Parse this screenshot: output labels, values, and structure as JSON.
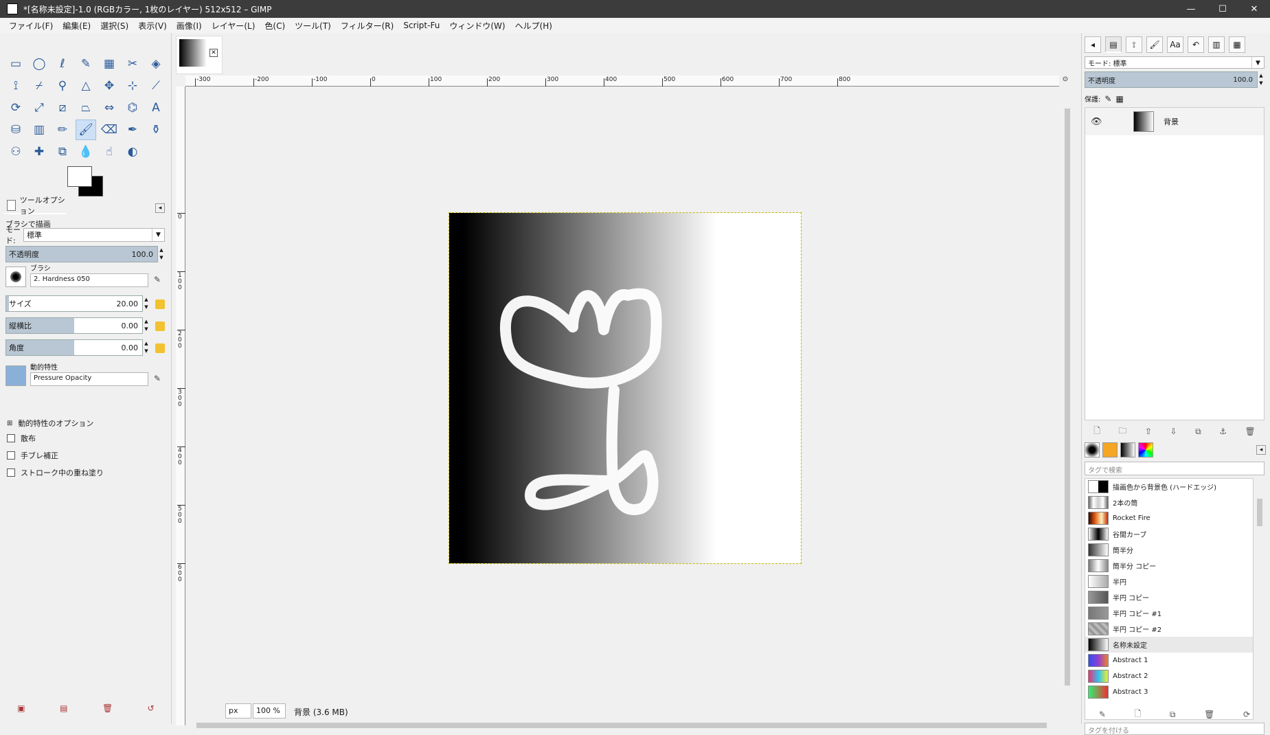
{
  "titlebar": {
    "title": "*[名称未設定]-1.0 (RGBカラー, 1枚のレイヤー) 512x512 – GIMP",
    "minimize": "—",
    "maximize": "☐",
    "close": "✕"
  },
  "menu": [
    "ファイル(F)",
    "編集(E)",
    "選択(S)",
    "表示(V)",
    "画像(I)",
    "レイヤー(L)",
    "色(C)",
    "ツール(T)",
    "フィルター(R)",
    "Script-Fu",
    "ウィンドウ(W)",
    "ヘルプ(H)"
  ],
  "tools": [
    {
      "name": "rect-select-tool",
      "glyph": "▭"
    },
    {
      "name": "ellipse-select-tool",
      "glyph": "◯"
    },
    {
      "name": "free-select-tool",
      "glyph": "ℓ"
    },
    {
      "name": "fuzzy-select-tool",
      "glyph": "✎"
    },
    {
      "name": "select-by-color-tool",
      "glyph": "▦"
    },
    {
      "name": "scissors-select-tool",
      "glyph": "✂"
    },
    {
      "name": "foreground-select-tool",
      "glyph": "◈"
    },
    {
      "name": "paths-tool",
      "glyph": "⟟"
    },
    {
      "name": "color-picker-tool",
      "glyph": "⌿"
    },
    {
      "name": "zoom-tool",
      "glyph": "⚲"
    },
    {
      "name": "measure-tool",
      "glyph": "△"
    },
    {
      "name": "move-tool",
      "glyph": "✥"
    },
    {
      "name": "align-tool",
      "glyph": "⊹"
    },
    {
      "name": "crop-tool",
      "glyph": "⟋"
    },
    {
      "name": "unified-transform-tool",
      "glyph": "⟳"
    },
    {
      "name": "scale-tool",
      "glyph": "⤢"
    },
    {
      "name": "shear-tool",
      "glyph": "⧄"
    },
    {
      "name": "perspective-tool",
      "glyph": "⏢"
    },
    {
      "name": "flip-tool",
      "glyph": "⇔"
    },
    {
      "name": "cage-tool",
      "glyph": "⌬"
    },
    {
      "name": "text-tool",
      "glyph": "A"
    },
    {
      "name": "bucket-fill-tool",
      "glyph": "⛁"
    },
    {
      "name": "gradient-tool",
      "glyph": "▥"
    },
    {
      "name": "pencil-tool",
      "glyph": "✏"
    },
    {
      "name": "paintbrush-tool",
      "glyph": "🖌"
    },
    {
      "name": "eraser-tool",
      "glyph": "⌫"
    },
    {
      "name": "airbrush-tool",
      "glyph": "✒"
    },
    {
      "name": "ink-tool",
      "glyph": "⚱"
    },
    {
      "name": "clone-tool",
      "glyph": "⚇"
    },
    {
      "name": "heal-tool",
      "glyph": "✚"
    },
    {
      "name": "perspective-clone-tool",
      "glyph": "⧉"
    },
    {
      "name": "blur-tool",
      "glyph": "💧"
    },
    {
      "name": "smudge-tool",
      "glyph": "☝"
    },
    {
      "name": "dodge-burn-tool",
      "glyph": "◐"
    }
  ],
  "tool_options": {
    "tab_label": "ツールオプション",
    "heading": "ブラシで描画",
    "mode_label": "モード:",
    "mode_value": "標準",
    "opacity_label": "不透明度",
    "opacity_value": "100.0",
    "brush_label": "ブラシ",
    "brush_value": "2. Hardness 050",
    "size_label": "サイズ",
    "size_value": "20.00",
    "aspect_label": "縦横比",
    "aspect_value": "0.00",
    "angle_label": "角度",
    "angle_value": "0.00",
    "dynamics_label": "動的特性",
    "dynamics_value": "Pressure Opacity",
    "dynamics_options": "動的特性のオプション",
    "scatter": "散布",
    "jitter": "手ブレ補正",
    "incremental": "ストローク中の重ね塗り"
  },
  "rulers": {
    "h": [
      {
        "label": "-300"
      },
      {
        "label": "-200"
      },
      {
        "label": "-100"
      },
      {
        "label": "0"
      },
      {
        "label": "100"
      },
      {
        "label": "200"
      },
      {
        "label": "300"
      },
      {
        "label": "400"
      },
      {
        "label": "500"
      },
      {
        "label": "600"
      },
      {
        "label": "700"
      },
      {
        "label": "800"
      }
    ],
    "v": [
      {
        "label": "0"
      },
      {
        "label": "1 0 0"
      },
      {
        "label": "2 0 0"
      },
      {
        "label": "3 0 0"
      },
      {
        "label": "4 0 0"
      },
      {
        "label": "5 0 0"
      },
      {
        "label": "6 0 0"
      }
    ]
  },
  "statusbar": {
    "unit": "px",
    "zoom": "100 %",
    "status": "背景 (3.6 MB)"
  },
  "right": {
    "mode_label": "モード: 標準",
    "opacity_label": "不透明度",
    "opacity_value": "100.0",
    "lock_label": "保護:",
    "layer_name": "背景",
    "gradient_search_placeholder": "タグで検索",
    "gradient_tag_placeholder": "タグを付ける"
  },
  "gradients": [
    {
      "name": "描画色から背景色 (ハードエッジ)",
      "css": "linear-gradient(90deg,#fff 50%,#000 50%)"
    },
    {
      "name": "2本の筒",
      "css": "linear-gradient(90deg,#666,#fff,#ccc,#fff,#666)"
    },
    {
      "name": "Rocket Fire",
      "css": "linear-gradient(90deg,#2a0800,#e85a10,#fff4c0,#c82800)"
    },
    {
      "name": "谷間カーブ",
      "css": "linear-gradient(90deg,#fff,#000,#fff)"
    },
    {
      "name": "筒半分",
      "css": "linear-gradient(90deg,#333,#fff)"
    },
    {
      "name": "筒半分 コピー",
      "css": "linear-gradient(90deg,#777,#fff,#888)"
    },
    {
      "name": "半円",
      "css": "linear-gradient(90deg,#fff,#aaa)"
    },
    {
      "name": "半円 コピー",
      "css": "linear-gradient(90deg,#999,#555)"
    },
    {
      "name": "半円 コピー #1",
      "css": "linear-gradient(90deg,#777,#999)"
    },
    {
      "name": "半円 コピー #2",
      "css": "repeating-linear-gradient(45deg,#bbb 0 4px,#999 4px 8px)"
    },
    {
      "name": "名称未設定",
      "css": "linear-gradient(90deg,#000,#fff)"
    },
    {
      "name": "Abstract 1",
      "css": "linear-gradient(90deg,#3050f0,#9040d0,#f08030)"
    },
    {
      "name": "Abstract 2",
      "css": "linear-gradient(90deg,#f03070,#30c0f0,#f0f030)"
    },
    {
      "name": "Abstract 3",
      "css": "linear-gradient(90deg,#30f070,#f03030)"
    }
  ]
}
